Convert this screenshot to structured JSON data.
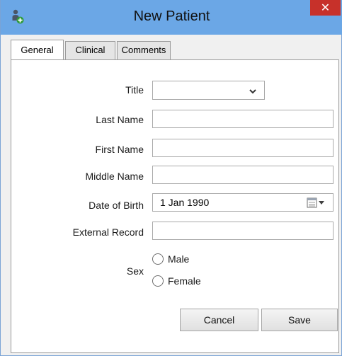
{
  "window": {
    "title": "New Patient",
    "close_glyph": "✕",
    "app_icon": "add-person-icon"
  },
  "tabs": [
    {
      "label": "General",
      "active": true
    },
    {
      "label": "Clinical",
      "active": false
    },
    {
      "label": "Comments",
      "active": false
    }
  ],
  "form": {
    "title_label": "Title",
    "title_value": "",
    "last_name_label": "Last Name",
    "last_name_value": "",
    "first_name_label": "First Name",
    "first_name_value": "",
    "middle_name_label": "Middle Name",
    "middle_name_value": "",
    "dob_label": "Date of Birth",
    "dob_value": "1 Jan  1990",
    "external_record_label": "External Record",
    "external_record_value": "",
    "sex_label": "Sex",
    "sex_options": [
      "Male",
      "Female"
    ],
    "sex_selected": ""
  },
  "buttons": {
    "cancel": "Cancel",
    "save": "Save"
  },
  "colors": {
    "titlebar": "#6ba7e6",
    "close": "#c7312a"
  }
}
